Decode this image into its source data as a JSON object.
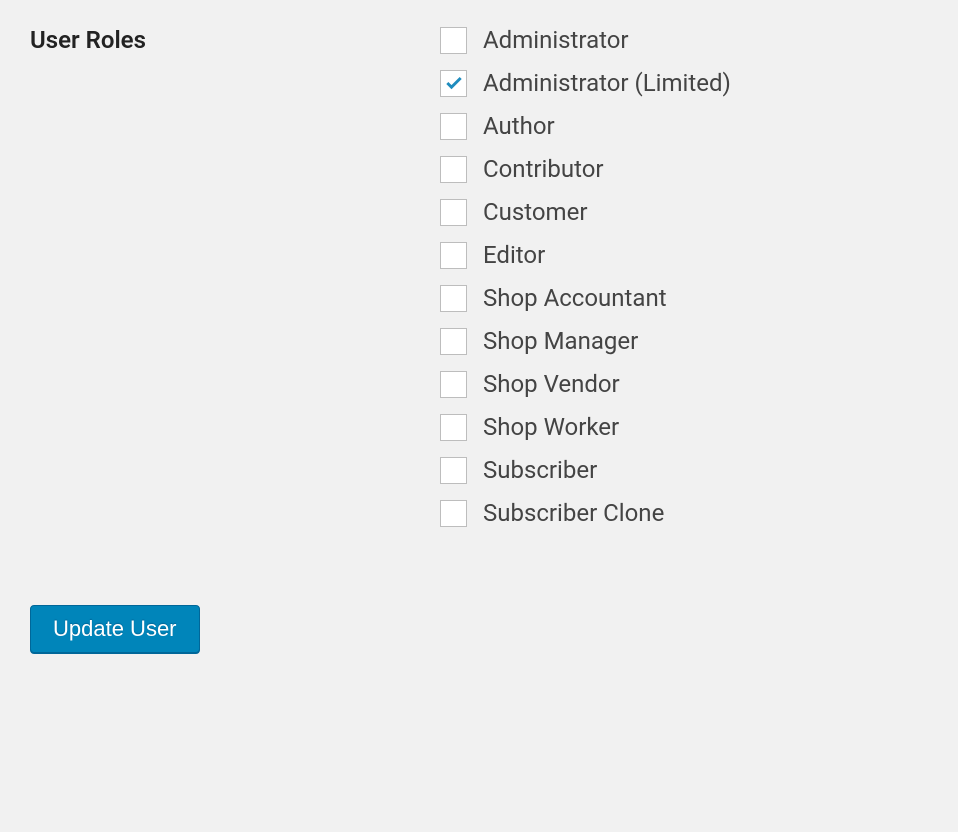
{
  "section": {
    "label": "User Roles"
  },
  "roles": [
    {
      "label": "Administrator",
      "checked": false
    },
    {
      "label": "Administrator (Limited)",
      "checked": true
    },
    {
      "label": "Author",
      "checked": false
    },
    {
      "label": "Contributor",
      "checked": false
    },
    {
      "label": "Customer",
      "checked": false
    },
    {
      "label": "Editor",
      "checked": false
    },
    {
      "label": "Shop Accountant",
      "checked": false
    },
    {
      "label": "Shop Manager",
      "checked": false
    },
    {
      "label": "Shop Vendor",
      "checked": false
    },
    {
      "label": "Shop Worker",
      "checked": false
    },
    {
      "label": "Subscriber",
      "checked": false
    },
    {
      "label": "Subscriber Clone",
      "checked": false
    }
  ],
  "actions": {
    "submit_label": "Update User"
  },
  "colors": {
    "accent": "#0085ba",
    "check": "#1e8cbe"
  }
}
